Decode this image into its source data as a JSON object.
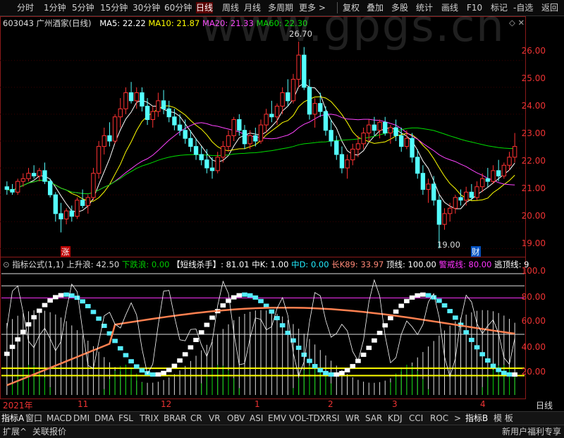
{
  "toolbar": {
    "periods": [
      "分时",
      "1分钟",
      "5分钟",
      "15分钟",
      "30分钟",
      "60分钟",
      "日线",
      "周线",
      "月线",
      "多周期",
      "更多 >"
    ],
    "actions": [
      "复权",
      "叠加",
      "多股",
      "统计",
      "画线",
      "F10",
      "标记",
      "-自选",
      "返回"
    ]
  },
  "main_info": {
    "code_name": "603043 广州酒家(日线)",
    "ma5": "MA5: 22.22",
    "ma10": "MA10: 21.87",
    "ma20": "MA20: 21.33",
    "ma60": "MA60: 22.30",
    "colors": {
      "ma5": "#ffffff",
      "ma10": "#ffff00",
      "ma20": "#ff44ff",
      "ma60": "#00dd00"
    }
  },
  "price_axis": [
    "26.00",
    "25.00",
    "24.00",
    "23.00",
    "22.00",
    "21.00",
    "20.00",
    "19.00"
  ],
  "annotations": {
    "high": "26.70",
    "low": "19.00",
    "rise_tag": "涨",
    "fin_tag": "财"
  },
  "indicator_info": {
    "name": "指标公式(1,1)",
    "up": "上升浪: 42.50",
    "down": "下跌浪: 0.00",
    "short": "【短线杀手】: 81.01",
    "k": "中K: 1.00",
    "d": "中D: 0.00",
    "k89": "长K89: 33.97",
    "top": "顶线: 100.00",
    "warn": "警戒线: 80.00",
    "escape": "逃顶线: 9"
  },
  "indicator_axis": [
    "100.0",
    "80.00",
    "60.00",
    "40.00",
    "20.00"
  ],
  "x_axis": [
    "2021年",
    "11",
    "12",
    "1",
    "2",
    "3",
    "4"
  ],
  "x_axis_right": "日线",
  "tabs": [
    "指标A",
    "窗口",
    "MACD",
    "DMI",
    "DMA",
    "FSL",
    "TRIX",
    "BRAR",
    "CR",
    "VR",
    "OBV",
    "ASI",
    "EMV",
    "VOL-TDX",
    "RSI",
    "WR",
    "SAR",
    "KDJ",
    "CCI",
    "ROC",
    ">",
    "指标B",
    "模 板"
  ],
  "status": {
    "left1": "扩展^",
    "left2": "关联报价",
    "right": "新用户福利专享"
  },
  "watermark": "www.gpgs.cn",
  "chart_data": {
    "type": "candlestick",
    "ylim": [
      18.8,
      27.2
    ],
    "ohlc": [
      [
        21.3,
        21.5,
        21.0,
        21.2
      ],
      [
        21.2,
        21.4,
        21.0,
        21.1
      ],
      [
        21.1,
        21.6,
        21.0,
        21.5
      ],
      [
        21.5,
        21.8,
        21.3,
        21.6
      ],
      [
        21.6,
        22.0,
        21.5,
        21.8
      ],
      [
        21.8,
        22.1,
        21.6,
        21.7
      ],
      [
        21.7,
        22.0,
        21.5,
        21.9
      ],
      [
        21.9,
        22.2,
        21.4,
        21.5
      ],
      [
        21.5,
        21.6,
        20.9,
        21.0
      ],
      [
        21.0,
        21.1,
        20.0,
        20.3
      ],
      [
        20.3,
        20.7,
        19.6,
        20.1
      ],
      [
        20.1,
        20.5,
        19.9,
        20.4
      ],
      [
        20.4,
        20.6,
        20.0,
        20.2
      ],
      [
        20.2,
        20.9,
        20.1,
        20.8
      ],
      [
        20.8,
        21.2,
        20.5,
        20.6
      ],
      [
        20.6,
        21.0,
        20.3,
        20.9
      ],
      [
        20.9,
        22.0,
        20.8,
        21.8
      ],
      [
        21.8,
        23.0,
        21.6,
        22.8
      ],
      [
        22.8,
        23.5,
        22.5,
        23.2
      ],
      [
        23.2,
        23.7,
        22.8,
        23.0
      ],
      [
        23.0,
        24.0,
        22.9,
        23.9
      ],
      [
        23.9,
        24.6,
        23.5,
        24.2
      ],
      [
        24.2,
        25.0,
        24.0,
        24.8
      ],
      [
        24.8,
        25.2,
        24.4,
        24.5
      ],
      [
        24.5,
        25.0,
        24.2,
        24.8
      ],
      [
        24.8,
        25.0,
        24.1,
        24.3
      ],
      [
        24.3,
        24.6,
        23.6,
        23.8
      ],
      [
        23.8,
        24.3,
        23.5,
        24.1
      ],
      [
        24.1,
        24.8,
        23.9,
        24.5
      ],
      [
        24.5,
        24.9,
        24.0,
        24.2
      ],
      [
        24.2,
        24.5,
        23.7,
        23.9
      ],
      [
        23.9,
        24.2,
        23.4,
        23.6
      ],
      [
        23.6,
        24.0,
        23.2,
        23.4
      ],
      [
        23.4,
        23.8,
        22.9,
        23.1
      ],
      [
        23.1,
        23.4,
        22.6,
        22.8
      ],
      [
        22.8,
        23.1,
        22.3,
        22.5
      ],
      [
        22.5,
        22.8,
        22.1,
        22.3
      ],
      [
        22.3,
        22.7,
        21.8,
        22.0
      ],
      [
        22.0,
        22.4,
        21.6,
        21.9
      ],
      [
        21.9,
        22.6,
        21.8,
        22.4
      ],
      [
        22.4,
        23.0,
        22.2,
        22.8
      ],
      [
        22.8,
        23.4,
        22.6,
        23.2
      ],
      [
        23.2,
        23.9,
        23.0,
        23.8
      ],
      [
        23.8,
        24.0,
        23.2,
        23.4
      ],
      [
        23.4,
        23.6,
        22.7,
        22.9
      ],
      [
        22.9,
        23.4,
        22.7,
        23.2
      ],
      [
        23.2,
        23.5,
        22.8,
        23.0
      ],
      [
        23.0,
        23.8,
        22.9,
        23.6
      ],
      [
        23.6,
        24.2,
        23.3,
        24.0
      ],
      [
        24.0,
        24.5,
        23.7,
        23.9
      ],
      [
        23.9,
        24.4,
        23.6,
        24.3
      ],
      [
        24.3,
        25.0,
        24.0,
        24.8
      ],
      [
        24.8,
        25.3,
        24.3,
        24.5
      ],
      [
        24.5,
        25.5,
        24.4,
        25.3
      ],
      [
        25.3,
        26.7,
        25.0,
        26.2
      ],
      [
        26.2,
        26.5,
        24.9,
        25.0
      ],
      [
        25.0,
        25.3,
        23.8,
        24.0
      ],
      [
        24.0,
        24.6,
        23.5,
        24.4
      ],
      [
        24.4,
        24.8,
        23.9,
        24.1
      ],
      [
        24.1,
        24.3,
        23.2,
        23.4
      ],
      [
        23.4,
        23.8,
        22.8,
        23.0
      ],
      [
        23.0,
        23.2,
        22.3,
        22.5
      ],
      [
        22.5,
        22.8,
        21.8,
        22.0
      ],
      [
        22.0,
        22.5,
        21.6,
        22.3
      ],
      [
        22.3,
        22.9,
        22.1,
        22.7
      ],
      [
        22.7,
        23.2,
        22.4,
        22.9
      ],
      [
        22.9,
        23.5,
        22.7,
        23.3
      ],
      [
        23.3,
        23.8,
        23.0,
        23.6
      ],
      [
        23.6,
        23.9,
        23.2,
        23.4
      ],
      [
        23.4,
        23.8,
        23.1,
        23.7
      ],
      [
        23.7,
        23.9,
        23.2,
        23.3
      ],
      [
        23.3,
        23.6,
        22.9,
        23.5
      ],
      [
        23.5,
        23.8,
        23.0,
        23.2
      ],
      [
        23.2,
        23.5,
        22.6,
        22.8
      ],
      [
        22.8,
        23.4,
        22.7,
        23.1
      ],
      [
        23.1,
        23.3,
        22.2,
        22.4
      ],
      [
        22.4,
        22.7,
        21.6,
        21.8
      ],
      [
        21.8,
        22.1,
        21.0,
        21.2
      ],
      [
        21.2,
        21.6,
        20.7,
        21.4
      ],
      [
        21.4,
        21.7,
        20.6,
        20.8
      ],
      [
        20.8,
        21.0,
        19.0,
        19.9
      ],
      [
        19.9,
        20.5,
        19.7,
        20.3
      ],
      [
        20.3,
        20.7,
        20.0,
        20.5
      ],
      [
        20.5,
        21.0,
        20.3,
        20.9
      ],
      [
        20.9,
        21.2,
        20.6,
        20.8
      ],
      [
        20.8,
        21.3,
        20.6,
        21.1
      ],
      [
        21.1,
        21.4,
        20.8,
        20.9
      ],
      [
        20.9,
        21.5,
        20.8,
        21.3
      ],
      [
        21.3,
        21.8,
        21.1,
        21.6
      ],
      [
        21.6,
        22.0,
        21.3,
        21.5
      ],
      [
        21.5,
        22.1,
        21.4,
        21.9
      ],
      [
        21.9,
        22.3,
        21.5,
        21.7
      ],
      [
        21.7,
        22.2,
        21.6,
        22.1
      ],
      [
        22.1,
        22.6,
        21.9,
        22.4
      ],
      [
        22.4,
        23.3,
        22.2,
        22.8
      ]
    ]
  }
}
